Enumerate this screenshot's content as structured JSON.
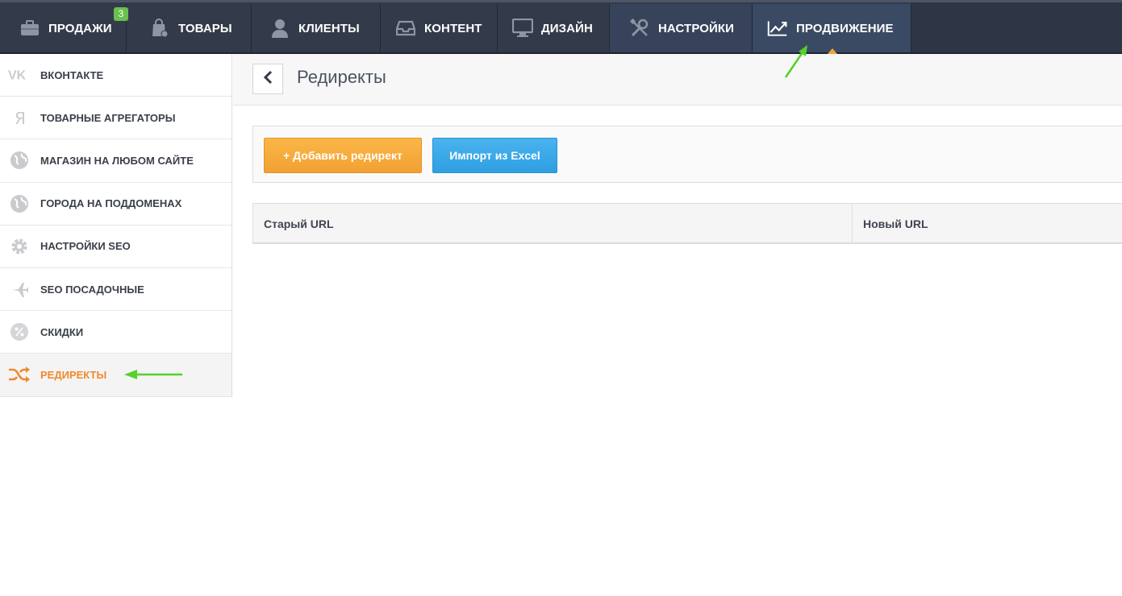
{
  "topnav": {
    "items": [
      {
        "label": "ПРОДАЖИ",
        "icon": "briefcase-icon",
        "badge": "3"
      },
      {
        "label": "ТОВАРЫ",
        "icon": "shopping-bag-icon"
      },
      {
        "label": "КЛИЕНТЫ",
        "icon": "user-icon"
      },
      {
        "label": "КОНТЕНТ",
        "icon": "inbox-icon"
      },
      {
        "label": "ДИЗАЙН",
        "icon": "monitor-icon"
      },
      {
        "label": "НАСТРОЙКИ",
        "icon": "tools-icon"
      },
      {
        "label": "ПРОДВИЖЕНИЕ",
        "icon": "trend-chart-icon",
        "active": true
      }
    ]
  },
  "sidebar": {
    "items": [
      {
        "label": "ВКОНТАКТЕ",
        "icon": "vk-icon"
      },
      {
        "label": "ТОВАРНЫЕ АГРЕГАТОРЫ",
        "icon": "yandex-icon"
      },
      {
        "label": "МАГАЗИН НА ЛЮБОМ САЙТЕ",
        "icon": "globe-icon"
      },
      {
        "label": "ГОРОДА НА ПОДДОМЕНАХ",
        "icon": "globe-icon"
      },
      {
        "label": "НАСТРОЙКИ SEO",
        "icon": "gear-icon"
      },
      {
        "label": "SEO ПОСАДОЧНЫЕ",
        "icon": "plane-icon"
      },
      {
        "label": "СКИДКИ",
        "icon": "percent-icon"
      },
      {
        "label": "РЕДИРЕКТЫ",
        "icon": "shuffle-icon",
        "active": true
      }
    ]
  },
  "header": {
    "title": "Редиректы",
    "back_icon": "chevron-left-icon"
  },
  "toolbar": {
    "add_label": "+ Добавить редирект",
    "import_label": "Импорт из Excel"
  },
  "table": {
    "columns": [
      "Старый URL",
      "Новый URL"
    ],
    "rows": []
  },
  "colors": {
    "nav_bg": "#333b4a",
    "nav_active": "#3b4a63",
    "accent_orange": "#f0892a",
    "button_orange": "#f7ab3d",
    "button_blue": "#3aa8e8",
    "badge_green": "#6bbf4e",
    "annotation_arrow": "#55d12a"
  }
}
